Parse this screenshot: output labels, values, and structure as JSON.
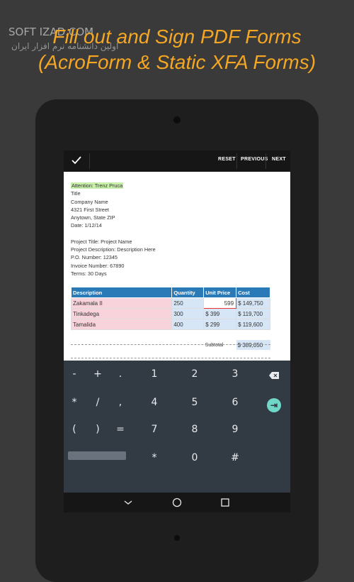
{
  "promo": {
    "line1": "Fill out and Sign PDF Forms",
    "line2": "(AcroForm & Static XFA Forms)",
    "watermark_logo": "SOFT IZAD.COM",
    "watermark_sub": "اولین دانشنامه نرم افزار ایران",
    "accent_color": "#f5a623"
  },
  "toolbar": {
    "done_icon": "checkmark-icon",
    "reset_label": "RESET",
    "previous_label": "PREVIOUS",
    "next_label": "NEXT"
  },
  "document": {
    "attention": "Attention: Trenz Pruca",
    "address": [
      "Title",
      "Company Name",
      "4321 First Street",
      "Anytown, State ZIP",
      "Date: 1/12/14"
    ],
    "project": [
      "Project Title: Project Name",
      "Project Description: Description Here",
      "P.O. Number: 12345",
      "Invoice Number: 67890",
      "Terms: 30 Days"
    ]
  },
  "table": {
    "headers": [
      "Description",
      "Quantity",
      "Unit Price",
      "Cost"
    ],
    "rows": [
      {
        "description": "Zakamala II",
        "quantity": "250",
        "unit_price": "599",
        "cost": "$ 149,750"
      },
      {
        "description": "Tinkadega",
        "quantity": "300",
        "unit_price": "$ 399",
        "cost": "$ 119,700"
      },
      {
        "description": "Tamalida",
        "quantity": "400",
        "unit_price": "$ 299",
        "cost": "$ 119,600"
      }
    ],
    "subtotal_label": "Subtotal",
    "subtotal_value": "$ 389,050",
    "header_color": "#2b7ab8"
  },
  "keypad": {
    "row1": [
      "-",
      "+",
      ".",
      "1",
      "2",
      "3"
    ],
    "row2": [
      "*",
      "/",
      ",",
      "4",
      "5",
      "6"
    ],
    "row3": [
      "(",
      ")",
      "=",
      "7",
      "8",
      "9"
    ],
    "row4_mid": "*",
    "row4_zero": "0",
    "row4_hash": "#",
    "backspace_icon": "backspace-icon",
    "tab_icon": "tab-icon",
    "tab_color": "#6fd6c8"
  },
  "navbar": {
    "back_icon": "back-chevron-icon",
    "home_icon": "home-circle-icon",
    "recents_icon": "recents-square-icon"
  }
}
